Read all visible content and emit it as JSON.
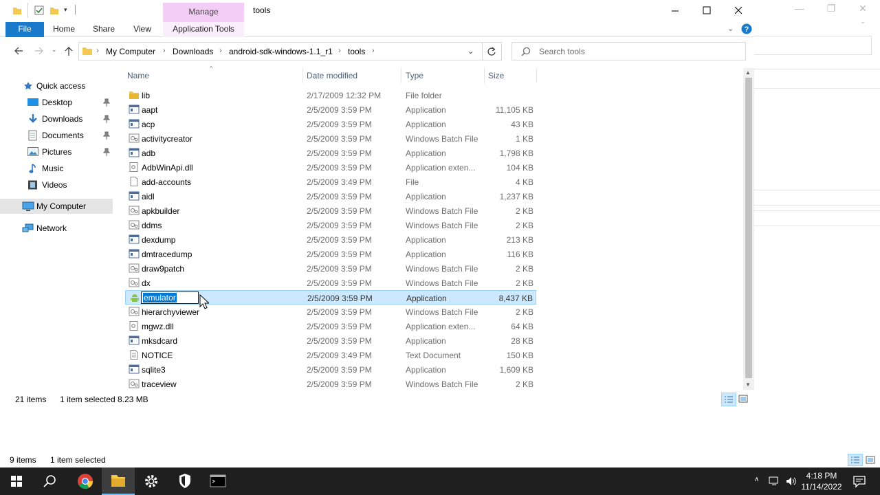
{
  "window": {
    "title": "tools",
    "manage_tab": "Manage"
  },
  "ribbon": {
    "tabs": [
      "File",
      "Home",
      "Share",
      "View",
      "Application Tools"
    ]
  },
  "address": {
    "crumbs": [
      "My Computer",
      "Downloads",
      "android-sdk-windows-1.1_r1",
      "tools"
    ]
  },
  "search": {
    "placeholder": "Search tools"
  },
  "nav": {
    "quick_access": "Quick access",
    "items": [
      {
        "label": "Desktop",
        "icon": "desktop-icon",
        "pinned": true
      },
      {
        "label": "Downloads",
        "icon": "download-arrow-icon",
        "pinned": true
      },
      {
        "label": "Documents",
        "icon": "documents-icon",
        "pinned": true
      },
      {
        "label": "Pictures",
        "icon": "pictures-icon",
        "pinned": true
      },
      {
        "label": "Music",
        "icon": "music-note-icon",
        "pinned": false
      },
      {
        "label": "Videos",
        "icon": "videos-icon",
        "pinned": false
      }
    ],
    "my_computer": "My Computer",
    "network": "Network"
  },
  "columns": {
    "name": "Name",
    "date": "Date modified",
    "type": "Type",
    "size": "Size"
  },
  "files": [
    {
      "name": "lib",
      "date": "2/17/2009 12:32 PM",
      "type": "File folder",
      "size": "",
      "icon": "folder-icon"
    },
    {
      "name": "aapt",
      "date": "2/5/2009 3:59 PM",
      "type": "Application",
      "size": "11,105 KB",
      "icon": "application-icon"
    },
    {
      "name": "acp",
      "date": "2/5/2009 3:59 PM",
      "type": "Application",
      "size": "43 KB",
      "icon": "application-icon"
    },
    {
      "name": "activitycreator",
      "date": "2/5/2009 3:59 PM",
      "type": "Windows Batch File",
      "size": "1 KB",
      "icon": "batch-file-icon"
    },
    {
      "name": "adb",
      "date": "2/5/2009 3:59 PM",
      "type": "Application",
      "size": "1,798 KB",
      "icon": "application-icon"
    },
    {
      "name": "AdbWinApi.dll",
      "date": "2/5/2009 3:59 PM",
      "type": "Application exten...",
      "size": "104 KB",
      "icon": "dll-file-icon"
    },
    {
      "name": "add-accounts",
      "date": "2/5/2009 3:49 PM",
      "type": "File",
      "size": "4 KB",
      "icon": "blank-file-icon"
    },
    {
      "name": "aidl",
      "date": "2/5/2009 3:59 PM",
      "type": "Application",
      "size": "1,237 KB",
      "icon": "application-icon"
    },
    {
      "name": "apkbuilder",
      "date": "2/5/2009 3:59 PM",
      "type": "Windows Batch File",
      "size": "2 KB",
      "icon": "batch-file-icon"
    },
    {
      "name": "ddms",
      "date": "2/5/2009 3:59 PM",
      "type": "Windows Batch File",
      "size": "2 KB",
      "icon": "batch-file-icon"
    },
    {
      "name": "dexdump",
      "date": "2/5/2009 3:59 PM",
      "type": "Application",
      "size": "213 KB",
      "icon": "application-icon"
    },
    {
      "name": "dmtracedump",
      "date": "2/5/2009 3:59 PM",
      "type": "Application",
      "size": "116 KB",
      "icon": "application-icon"
    },
    {
      "name": "draw9patch",
      "date": "2/5/2009 3:59 PM",
      "type": "Windows Batch File",
      "size": "2 KB",
      "icon": "batch-file-icon"
    },
    {
      "name": "dx",
      "date": "2/5/2009 3:59 PM",
      "type": "Windows Batch File",
      "size": "2 KB",
      "icon": "batch-file-icon"
    },
    {
      "name": "emulator",
      "date": "2/5/2009 3:59 PM",
      "type": "Application",
      "size": "8,437 KB",
      "icon": "android-app-icon",
      "selected": true
    },
    {
      "name": "hierarchyviewer",
      "date": "2/5/2009 3:59 PM",
      "type": "Windows Batch File",
      "size": "2 KB",
      "icon": "batch-file-icon"
    },
    {
      "name": "mgwz.dll",
      "date": "2/5/2009 3:59 PM",
      "type": "Application exten...",
      "size": "64 KB",
      "icon": "dll-file-icon"
    },
    {
      "name": "mksdcard",
      "date": "2/5/2009 3:59 PM",
      "type": "Application",
      "size": "28 KB",
      "icon": "application-icon"
    },
    {
      "name": "NOTICE",
      "date": "2/5/2009 3:49 PM",
      "type": "Text Document",
      "size": "150 KB",
      "icon": "text-file-icon"
    },
    {
      "name": "sqlite3",
      "date": "2/5/2009 3:59 PM",
      "type": "Application",
      "size": "1,609 KB",
      "icon": "application-icon"
    },
    {
      "name": "traceview",
      "date": "2/5/2009 3:59 PM",
      "type": "Windows Batch File",
      "size": "2 KB",
      "icon": "batch-file-icon"
    }
  ],
  "status": {
    "items": "21 items",
    "selected": "1 item selected",
    "size": "8.23 MB"
  },
  "bg_status": {
    "items": "9 items",
    "selected": "1 item selected"
  },
  "taskbar": {
    "time": "4:18 PM",
    "date": "11/14/2022"
  }
}
